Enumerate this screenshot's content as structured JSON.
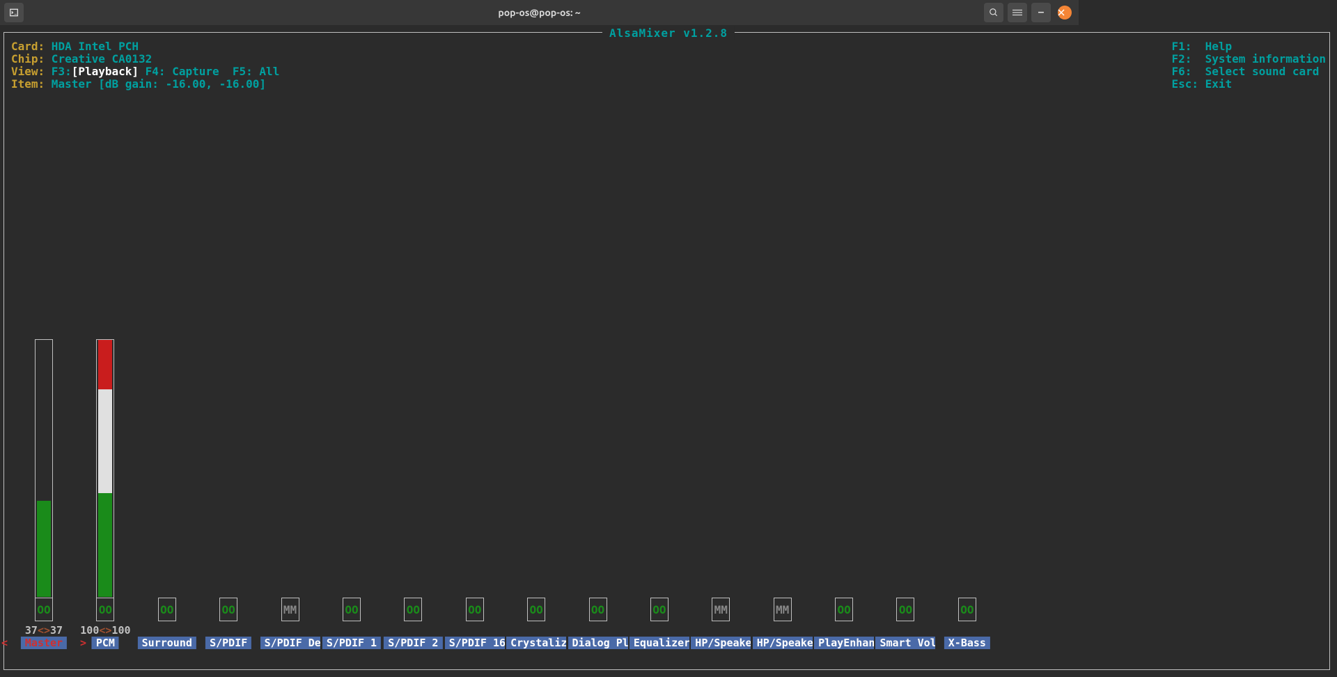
{
  "window_title": "pop-os@pop-os: ~",
  "app_title": "AlsaMixer v1.2.8",
  "info": {
    "card_label": "Card:",
    "card_value": " HDA Intel PCH",
    "chip_label": "Chip:",
    "chip_value": " Creative CA0132",
    "view_label": "View:",
    "view_f3": " F3:",
    "view_playback": "[Playback]",
    "view_rest": " F4: Capture  F5: All",
    "item_label": "Item:",
    "item_value": " Master [dB gain: -16.00, -16.00]"
  },
  "help": {
    "f1": "F1:  Help",
    "f2": "F2:  System information",
    "f6": "F6:  Select sound card",
    "esc": "Esc: Exit"
  },
  "channels": [
    {
      "name": "Master",
      "has_meter": true,
      "level_l": "37",
      "level_r": "37",
      "mute": "OO",
      "selected": true,
      "fill_pct": 37,
      "zones": [
        [
          "green",
          37
        ]
      ]
    },
    {
      "name": "PCM",
      "has_meter": true,
      "level_l": "100",
      "level_r": "100",
      "mute": "OO",
      "selected": false,
      "fill_pct": 100,
      "zones": [
        [
          "green",
          40
        ],
        [
          "white",
          40
        ],
        [
          "red",
          20
        ]
      ]
    },
    {
      "name": "Surround",
      "has_meter": false,
      "mute": "OO",
      "selected": false
    },
    {
      "name": "S/PDIF",
      "has_meter": false,
      "mute": "OO",
      "selected": false
    },
    {
      "name": "S/PDIF Def",
      "has_meter": false,
      "mute": "MM",
      "selected": false
    },
    {
      "name": "S/PDIF 1",
      "has_meter": false,
      "mute": "OO",
      "selected": false
    },
    {
      "name": "S/PDIF 2",
      "has_meter": false,
      "mute": "OO",
      "selected": false
    },
    {
      "name": "S/PDIF 16",
      "has_meter": false,
      "mute": "OO",
      "selected": false
    },
    {
      "name": "Crystalize",
      "has_meter": false,
      "mute": "OO",
      "selected": false
    },
    {
      "name": "Dialog Plu",
      "has_meter": false,
      "mute": "OO",
      "selected": false
    },
    {
      "name": "Equalizer",
      "has_meter": false,
      "mute": "OO",
      "selected": false
    },
    {
      "name": "HP/Speaker",
      "has_meter": false,
      "mute": "MM",
      "selected": false
    },
    {
      "name": "HP/Speaker",
      "has_meter": false,
      "mute": "MM",
      "selected": false
    },
    {
      "name": "PlayEnhanc",
      "has_meter": false,
      "mute": "OO",
      "selected": false
    },
    {
      "name": "Smart Volu",
      "has_meter": false,
      "mute": "OO",
      "selected": false
    },
    {
      "name": "X-Bass",
      "has_meter": false,
      "mute": "OO",
      "selected": false
    }
  ],
  "level_sep": "<>",
  "sel_marker": {
    "left": "<",
    "right": ">"
  }
}
